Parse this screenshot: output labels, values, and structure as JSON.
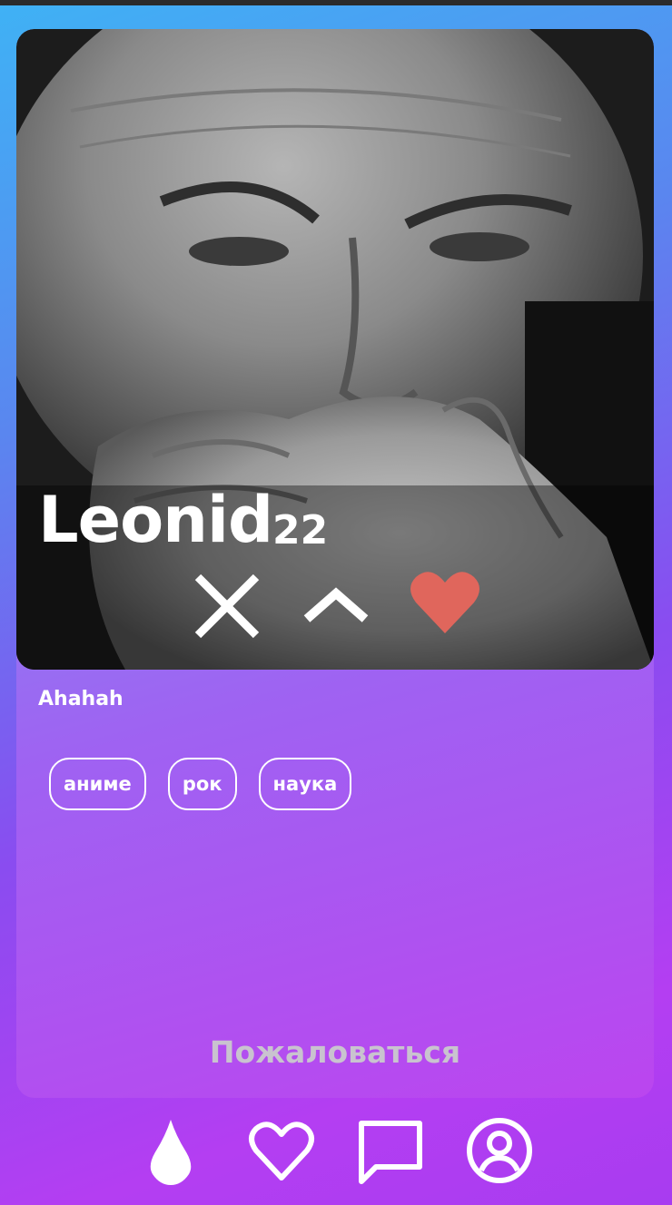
{
  "profile": {
    "name": "Leonid",
    "age": "22",
    "bio": "Ahahah",
    "tags": [
      "аниме",
      "рок",
      "наука"
    ]
  },
  "actions": {
    "reject_icon": "close-icon",
    "expand_icon": "chevron-up-icon",
    "like_icon": "heart-icon",
    "like_color": "#e0665c"
  },
  "report_label": "Пожаловаться",
  "nav": {
    "items": [
      {
        "icon": "drop-icon",
        "active": true
      },
      {
        "icon": "heart-outline-icon",
        "active": false
      },
      {
        "icon": "chat-icon",
        "active": false
      },
      {
        "icon": "user-circle-icon",
        "active": false
      }
    ]
  },
  "colors": {
    "gradient_start": "#3fb2f5",
    "gradient_end": "#b43ef2",
    "report_text": "#c9c3cf"
  }
}
